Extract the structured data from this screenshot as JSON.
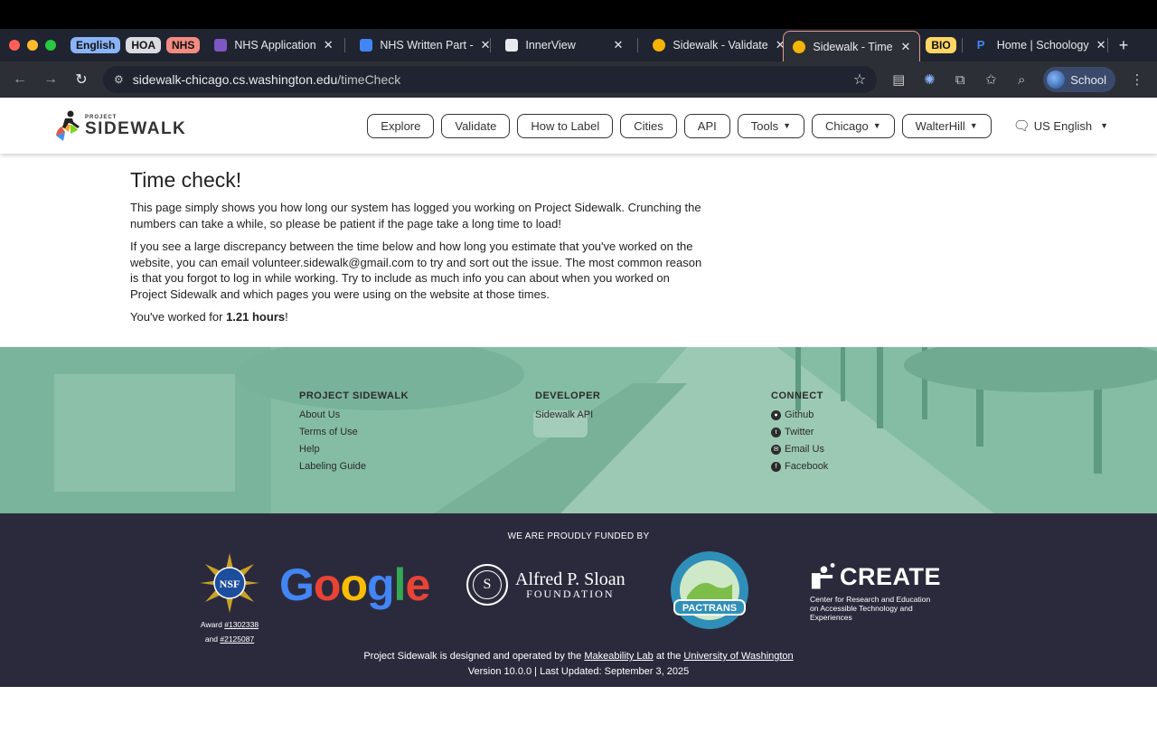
{
  "browser": {
    "group_pills": [
      {
        "label": "English",
        "color": "#8ab4f8"
      },
      {
        "label": "HOA",
        "color": "#dadce0"
      },
      {
        "label": "NHS",
        "color": "#f28b82"
      }
    ],
    "tabs": [
      {
        "title": "NHS Application",
        "favicon_color": "#7e57c2",
        "active": false
      },
      {
        "title": "NHS Written Part -",
        "favicon_color": "#4285f4",
        "active": false
      },
      {
        "title": "InnerView",
        "favicon_color": "#e8eaed",
        "active": false
      },
      {
        "title": "Sidewalk - Validate",
        "favicon_color": "#f4b400",
        "active": false
      },
      {
        "title": "Sidewalk - Time Ch",
        "favicon_color": "#f4b400",
        "active": true
      }
    ],
    "bio_pill": {
      "label": "BIO",
      "color": "#fdd663"
    },
    "last_tab": {
      "title": "Home | Schoology",
      "favicon_color": "#4285f4"
    },
    "close_glyph": "✕",
    "new_tab_glyph": "+",
    "url_host": "sidewalk-chicago.cs.washington.edu",
    "url_path": "/timeCheck",
    "profile_label": "School"
  },
  "site": {
    "logo_small": "PROJECT",
    "logo_big": "SIDEWALK",
    "nav": [
      {
        "label": "Explore",
        "dropdown": false
      },
      {
        "label": "Validate",
        "dropdown": false
      },
      {
        "label": "How to Label",
        "dropdown": false
      },
      {
        "label": "Cities",
        "dropdown": false
      },
      {
        "label": "API",
        "dropdown": false
      },
      {
        "label": "Tools",
        "dropdown": true
      },
      {
        "label": "Chicago",
        "dropdown": true
      },
      {
        "label": "WalterHill",
        "dropdown": true
      }
    ],
    "language": "US English"
  },
  "main": {
    "title": "Time check!",
    "para1": "This page simply shows you how long our system has logged you working on Project Sidewalk. Crunching the numbers can take a while, so please be patient if the page take a long time to load!",
    "para2": "If you see a large discrepancy between the time below and how long you estimate that you've worked on the website, you can email volunteer.sidewalk@gmail.com to try and sort out the issue. The most common reason is that you forgot to log in while working. Try to include as much info you can about when you worked on Project Sidewalk and which pages you were using on the website at those times.",
    "worked_prefix": "You've worked for ",
    "worked_value": "1.21 hours",
    "worked_suffix": "!"
  },
  "footer": {
    "col1": {
      "heading": "PROJECT SIDEWALK",
      "links": [
        "About Us",
        "Terms of Use",
        "Help",
        "Labeling Guide"
      ]
    },
    "col2": {
      "heading": "DEVELOPER",
      "links": [
        "Sidewalk API"
      ]
    },
    "col3": {
      "heading": "CONNECT",
      "links": [
        {
          "label": "Github",
          "icon": "github-icon"
        },
        {
          "label": "Twitter",
          "icon": "twitter-icon"
        },
        {
          "label": "Email Us",
          "icon": "email-icon"
        },
        {
          "label": "Facebook",
          "icon": "facebook-icon"
        }
      ]
    },
    "funded_by": "WE ARE PROUDLY FUNDED BY",
    "nsf_label": "NSF",
    "award_prefix": "Award ",
    "award1": "#1302338",
    "award_and": "and ",
    "award2": "#2125087",
    "google": "Google",
    "sloan_line1": "Alfred P. Sloan",
    "sloan_line2": "FOUNDATION",
    "pactrans": "PACTRANS",
    "create_word": "CREATE",
    "create_sub": "Center for Research and Education on Accessible Technology and Experiences",
    "credits_prefix": "Project Sidewalk is designed and operated by the ",
    "credits_lab": "Makeability Lab",
    "credits_mid": " at the ",
    "credits_uni": "University of Washington",
    "version": "Version 10.0.0 | Last Updated: September 3, 2025"
  }
}
